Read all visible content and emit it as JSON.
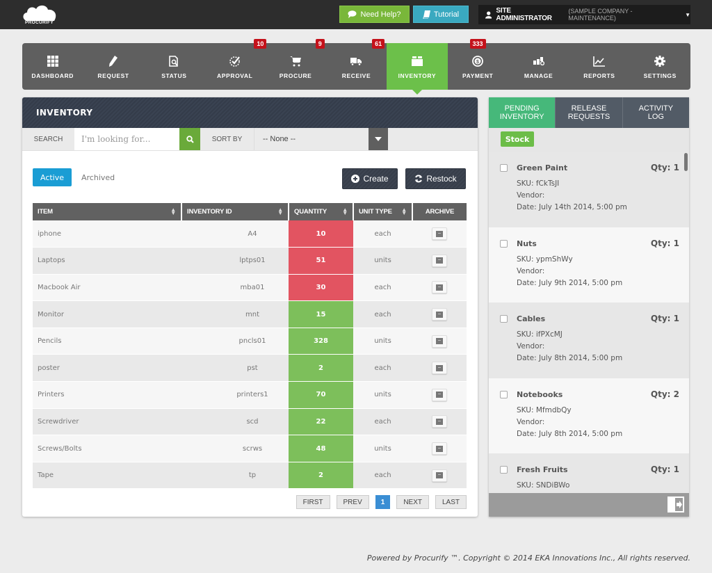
{
  "app": {
    "logo_text": "PROCURIFY",
    "help_label": "Need Help?",
    "tutorial_label": "Tutorial",
    "user_role": "SITE ADMINISTRATOR",
    "user_company": "(SAMPLE COMPANY - MAINTENANCE)"
  },
  "nav": {
    "items": [
      {
        "label": "DASHBOARD",
        "icon": "grid-icon"
      },
      {
        "label": "REQUEST",
        "icon": "pencil-icon"
      },
      {
        "label": "STATUS",
        "icon": "document-search-icon"
      },
      {
        "label": "APPROVAL",
        "icon": "check-icon",
        "badge": "10"
      },
      {
        "label": "PROCURE",
        "icon": "cart-icon",
        "badge": "9"
      },
      {
        "label": "RECEIVE",
        "icon": "truck-icon",
        "badge": "61"
      },
      {
        "label": "INVENTORY",
        "icon": "box-icon",
        "active": true
      },
      {
        "label": "PAYMENT",
        "icon": "coin-icon",
        "badge": "333"
      },
      {
        "label": "MANAGE",
        "icon": "manage-icon"
      },
      {
        "label": "REPORTS",
        "icon": "chart-icon"
      },
      {
        "label": "SETTINGS",
        "icon": "gear-icon"
      }
    ]
  },
  "inventory": {
    "title": "INVENTORY",
    "search_label": "SEARCH",
    "search_placeholder": "I'm looking for...",
    "sort_label": "SORT BY",
    "sort_value": "-- None --",
    "tab_active": "Active",
    "tab_archived": "Archived",
    "create_label": "Create",
    "restock_label": "Restock",
    "columns": [
      "ITEM",
      "INVENTORY ID",
      "QUANTITY",
      "UNIT TYPE",
      "ARCHIVE"
    ],
    "rows": [
      {
        "item": "iphone",
        "id": "A4",
        "qty": "10",
        "unit": "each",
        "status": "low"
      },
      {
        "item": "Laptops",
        "id": "lptps01",
        "qty": "51",
        "unit": "units",
        "status": "low"
      },
      {
        "item": "Macbook Air",
        "id": "mba01",
        "qty": "30",
        "unit": "each",
        "status": "low"
      },
      {
        "item": "Monitor",
        "id": "mnt",
        "qty": "15",
        "unit": "each",
        "status": "ok"
      },
      {
        "item": "Pencils",
        "id": "pncls01",
        "qty": "328",
        "unit": "units",
        "status": "ok"
      },
      {
        "item": "poster",
        "id": "pst",
        "qty": "2",
        "unit": "each",
        "status": "ok"
      },
      {
        "item": "Printers",
        "id": "printers1",
        "qty": "70",
        "unit": "units",
        "status": "ok"
      },
      {
        "item": "Screwdriver",
        "id": "scd",
        "qty": "22",
        "unit": "each",
        "status": "ok"
      },
      {
        "item": "Screws/Bolts",
        "id": "scrws",
        "qty": "48",
        "unit": "units",
        "status": "ok"
      },
      {
        "item": "Tape",
        "id": "tp",
        "qty": "2",
        "unit": "each",
        "status": "ok"
      }
    ],
    "pager": {
      "first": "FIRST",
      "prev": "PREV",
      "current": "1",
      "next": "NEXT",
      "last": "LAST"
    }
  },
  "side": {
    "tabs": [
      "PENDING\nINVENTORY",
      "RELEASE\nREQUESTS",
      "ACTIVITY\nLOG"
    ],
    "stock_label": "Stock",
    "items": [
      {
        "name": "Green Paint",
        "qty": "Qty: 1",
        "sku": "SKU: fCkTsJI",
        "vendor": "Vendor:",
        "date": "Date: July 14th 2014, 5:00 pm"
      },
      {
        "name": "Nuts",
        "qty": "Qty: 1",
        "sku": "SKU: ypmShWy",
        "vendor": "Vendor:",
        "date": "Date: July 9th 2014, 5:00 pm"
      },
      {
        "name": "Cables",
        "qty": "Qty: 1",
        "sku": "SKU: ifPXcMJ",
        "vendor": "Vendor:",
        "date": "Date: July 8th 2014, 5:00 pm"
      },
      {
        "name": "Notebooks",
        "qty": "Qty: 2",
        "sku": "SKU: MfmdbQy",
        "vendor": "Vendor:",
        "date": "Date: July 8th 2014, 5:00 pm"
      },
      {
        "name": "Fresh Fruits",
        "qty": "Qty: 1",
        "sku": "SKU: SNDiBWo",
        "vendor": "",
        "date": ""
      }
    ]
  },
  "footer": "Powered by Procurify ™. Copyright © 2014 EKA Innovations Inc., All rights reserved.",
  "colors": {
    "active_green": "#6cc04a",
    "badge_red": "#c4121b",
    "qty_low": "#e25461",
    "qty_ok": "#7dbf5b",
    "tab_active": "#46b87a",
    "pill_blue": "#1a9dd4"
  }
}
